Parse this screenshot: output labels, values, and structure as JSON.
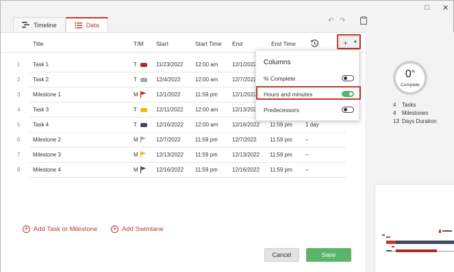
{
  "window": {
    "maximize_icon": "square",
    "close_icon": "x"
  },
  "tabs": [
    {
      "label": "Timeline",
      "icon": "timeline-icon"
    },
    {
      "label": "Data",
      "icon": "list-icon"
    }
  ],
  "columns": {
    "title": "Title",
    "tm": "T/M",
    "start": "Start",
    "start_time": "Start Time",
    "end": "End",
    "end_time": "End Time"
  },
  "rows": [
    {
      "num": "1",
      "title": "Task 1",
      "tm": "T",
      "start": "11/23/2022",
      "start_time": "12:00 am",
      "end": "12/1/2022",
      "end_time": "",
      "duration": "",
      "mark": "swatch",
      "color": "#b3262b"
    },
    {
      "num": "2",
      "title": "Task 2",
      "tm": "T",
      "start": "12/4/2022",
      "start_time": "12:00 am",
      "end": "12/7/2022",
      "end_time": "",
      "duration": "",
      "mark": "swatch",
      "color": "#a6a6a6"
    },
    {
      "num": "3",
      "title": "Milestone 1",
      "tm": "M",
      "start": "12/1/2022",
      "start_time": "11:59 pm",
      "end": "12/1/2022",
      "end_time": "",
      "duration": "",
      "mark": "flag",
      "color": "#c0272d"
    },
    {
      "num": "4",
      "title": "Task 3",
      "tm": "T",
      "start": "12/11/2022",
      "start_time": "12:00 am",
      "end": "12/13/2022",
      "end_time": "",
      "duration": "",
      "mark": "swatch",
      "color": "#f2b81b"
    },
    {
      "num": "5",
      "title": "Task 4",
      "tm": "T",
      "start": "12/16/2022",
      "start_time": "12:00 am",
      "end": "12/16/2022",
      "end_time": "11:59 pm",
      "duration": "1 day",
      "mark": "swatch",
      "color": "#3d4a5c"
    },
    {
      "num": "6",
      "title": "Milestone 2",
      "tm": "M",
      "start": "12/7/2022",
      "start_time": "11:59 pm",
      "end": "12/7/2022",
      "end_time": "11:59 pm",
      "duration": "–",
      "mark": "flag",
      "color": "#a6a6a6"
    },
    {
      "num": "7",
      "title": "Milestone 3",
      "tm": "M",
      "start": "12/13/2022",
      "start_time": "11:59 pm",
      "end": "12/13/2022",
      "end_time": "11:59 pm",
      "duration": "–",
      "mark": "flag",
      "color": "#f2b81b"
    },
    {
      "num": "8",
      "title": "Milestone 4",
      "tm": "M",
      "start": "12/16/2022",
      "start_time": "11:59 pm",
      "end": "12/16/2022",
      "end_time": "11:59 pm",
      "duration": "–",
      "mark": "flag",
      "color": "#3d4a5c"
    }
  ],
  "add_task_label": "Add Task or Milestone",
  "add_swimlane_label": "Add Swimlane",
  "cancel_label": "Cancel",
  "save_label": "Save",
  "popup": {
    "title": "Columns",
    "options": [
      {
        "label": "% Complete",
        "on": false
      },
      {
        "label": "Hours and minutes",
        "on": true
      },
      {
        "label": "Predecessors",
        "on": false
      }
    ]
  },
  "progress": {
    "value": "0",
    "unit": "%",
    "label": "Complete"
  },
  "stats": [
    {
      "count": "4",
      "label": "Tasks"
    },
    {
      "count": "4",
      "label": "Milestones"
    },
    {
      "count": "13",
      "label": "Days Duration"
    }
  ],
  "colors": {
    "accent": "#c0392b",
    "toggle_on": "#5ab46a",
    "save": "#5ab46a"
  }
}
